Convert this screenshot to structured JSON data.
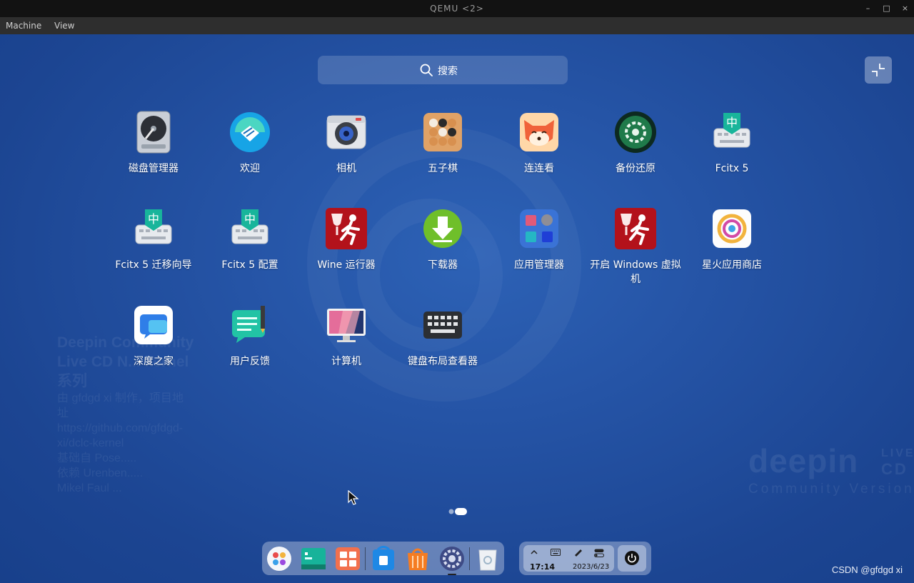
{
  "window": {
    "title": "QEMU <2>",
    "controls": [
      "–",
      "□",
      "×"
    ]
  },
  "menubar": [
    "Machine",
    "View"
  ],
  "search": {
    "placeholder": "搜索"
  },
  "apps": [
    {
      "name": "磁盘管理器",
      "icon": "disk-manager-icon"
    },
    {
      "name": "欢迎",
      "icon": "welcome-handshake-icon"
    },
    {
      "name": "相机",
      "icon": "camera-icon"
    },
    {
      "name": "五子棋",
      "icon": "gomoku-icon"
    },
    {
      "name": "连连看",
      "icon": "link-game-fox-icon"
    },
    {
      "name": "备份还原",
      "icon": "backup-restore-icon"
    },
    {
      "name": "Fcitx 5",
      "icon": "fcitx-keyboard-icon"
    },
    {
      "name": "Fcitx 5 迁移向导",
      "icon": "fcitx-keyboard-icon"
    },
    {
      "name": "Fcitx 5 配置",
      "icon": "fcitx-keyboard-icon"
    },
    {
      "name": "Wine 运行器",
      "icon": "wine-runner-icon"
    },
    {
      "name": "下载器",
      "icon": "downloader-icon"
    },
    {
      "name": "应用管理器",
      "icon": "app-manager-icon"
    },
    {
      "name": "开启 Windows 虚拟机",
      "icon": "wine-runner-icon"
    },
    {
      "name": "星火应用商店",
      "icon": "spark-store-icon"
    },
    {
      "name": "深度之家",
      "icon": "deepin-home-icon"
    },
    {
      "name": "用户反馈",
      "icon": "feedback-icon"
    },
    {
      "name": "计算机",
      "icon": "computer-icon"
    },
    {
      "name": "键盘布局查看器",
      "icon": "keyboard-layout-icon"
    }
  ],
  "background_text": {
    "lines": [
      "Deepin Community",
      "Live CD N... kernel",
      "系列",
      "由 gfdgd xi 制作，项目地",
      "址",
      "https://github.com/gfdgd-",
      "xi/dclc-kernel",
      "基础自 Pose.....",
      "依赖 Urenben.....",
      "Mikel Faul ..."
    ],
    "logo": "deepin",
    "logo_live": "LIVE",
    "logo_cd": "CD",
    "logo_sub": "Community Version"
  },
  "dock": {
    "apps": [
      "launcher-icon",
      "terminal-icon",
      "multitasking-icon",
      "app-store-icon",
      "spark-bag-icon",
      "control-center-icon",
      "trash-icon"
    ],
    "tray": {
      "time": "17:14",
      "date": "2023/6/23"
    }
  },
  "watermark": "CSDN @gfdgd xi",
  "colors": {
    "desktop": "#2554a6",
    "titlebar": "#121212",
    "menubar": "#2e2e2e"
  }
}
